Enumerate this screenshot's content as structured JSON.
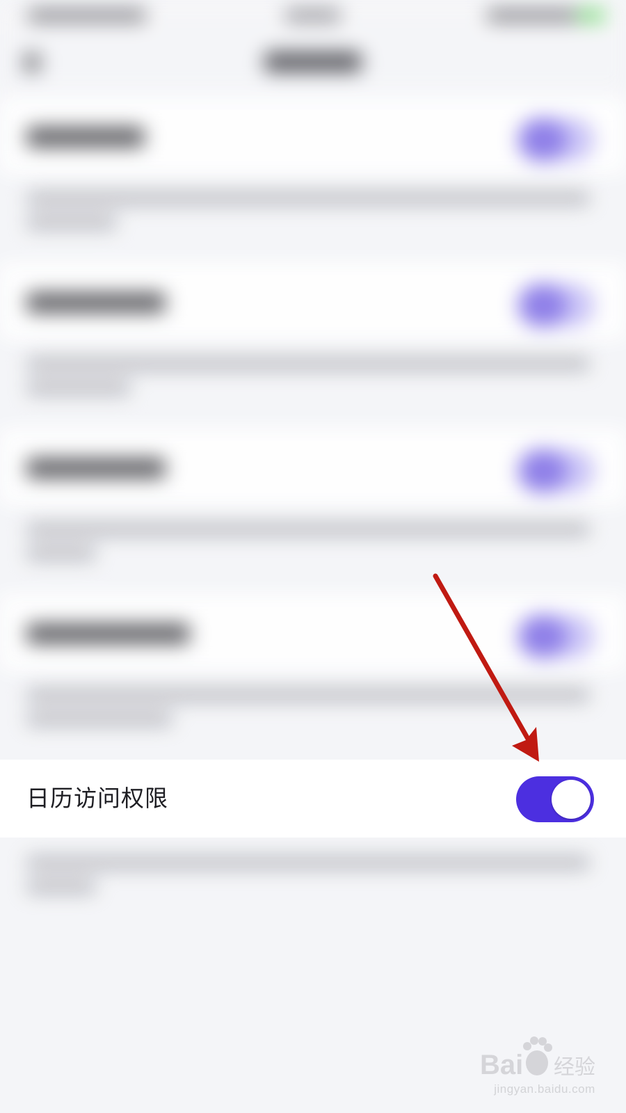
{
  "focused_setting": {
    "label": "日历访问权限",
    "toggle_state": "on"
  },
  "colors": {
    "toggle_on": "#4c2fe0",
    "arrow": "#c01a12",
    "background": "#f4f5f8"
  },
  "watermark": {
    "brand": "Bai 经验",
    "url": "jingyan.baidu.com"
  }
}
